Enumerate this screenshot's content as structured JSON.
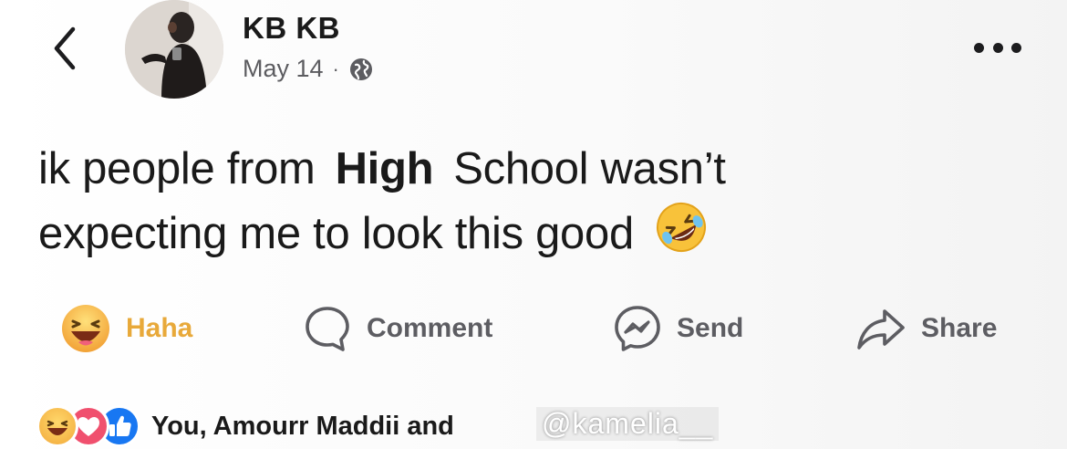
{
  "post": {
    "author_name": "KB KB",
    "date": "May 14",
    "separator": "·",
    "text_part1": "ik people from",
    "text_highlight": "High",
    "text_part2": "School wasn’t",
    "text_line2": "expecting me to look this good",
    "emoji": "🤣"
  },
  "actions": {
    "haha_label": "Haha",
    "comment_label": "Comment",
    "send_label": "Send",
    "share_label": "Share"
  },
  "reactions": {
    "summary": "You, Amourr Maddii and"
  },
  "watermark": {
    "text": "@kamelia__"
  },
  "colors": {
    "haha_active": "#e8a93a",
    "like_blue": "#1877f2",
    "love_pink": "#f0506e",
    "text_dark": "#1a1a1a",
    "text_muted": "#5c5c60"
  },
  "icons": {
    "back": "chevron-left-icon",
    "privacy": "globe-icon",
    "more": "more-dots-icon",
    "haha": "haha-emoji-icon",
    "comment": "comment-bubble-icon",
    "send": "messenger-icon",
    "share": "share-arrow-icon"
  }
}
